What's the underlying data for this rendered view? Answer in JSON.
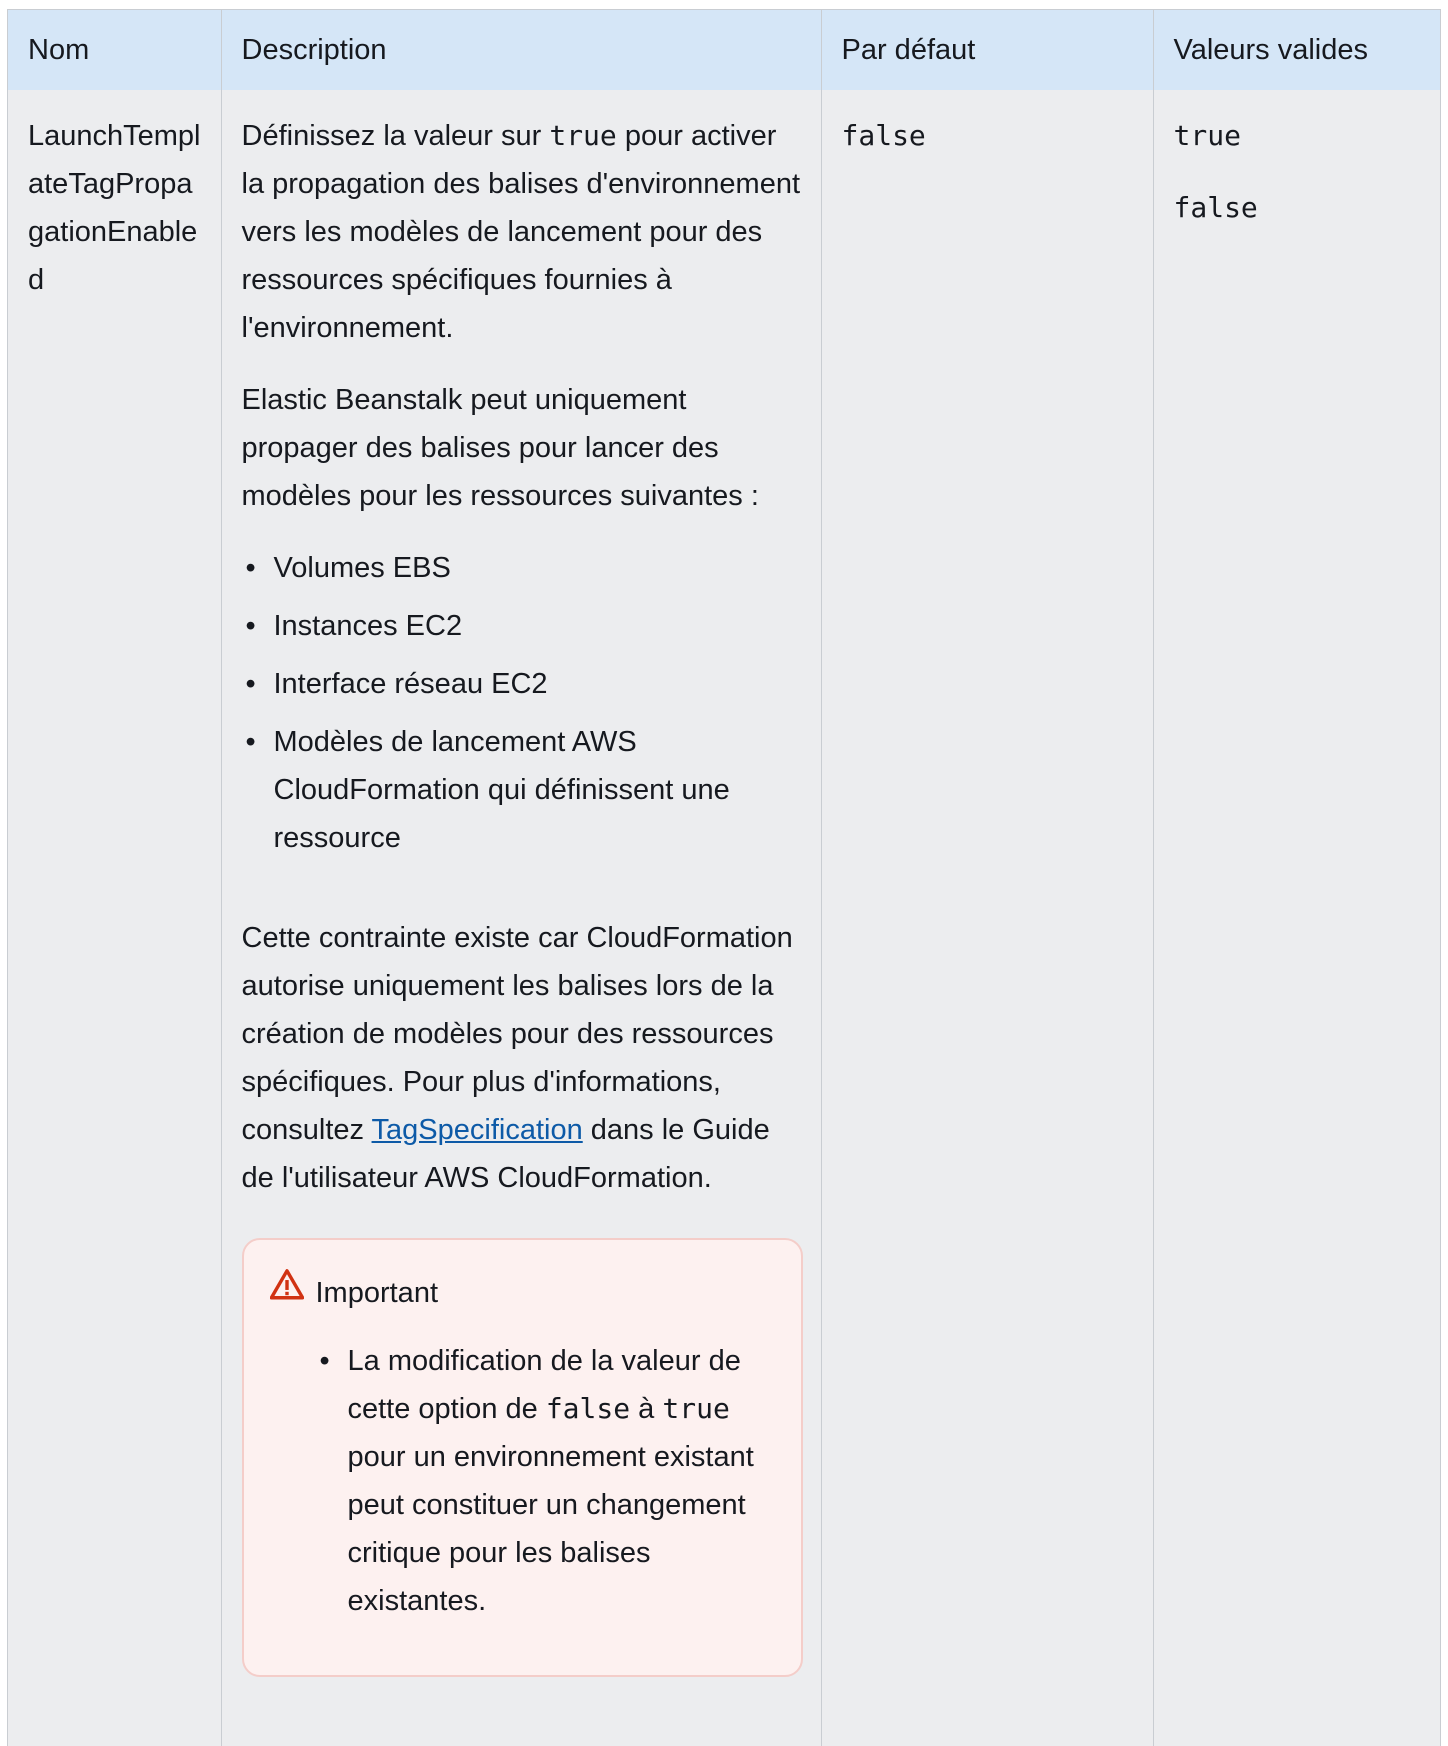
{
  "headers": {
    "name": "Nom",
    "description": "Description",
    "default": "Par défaut",
    "valid_values": "Valeurs valides"
  },
  "row": {
    "name": "LaunchTemplateTagPropagationEnabled",
    "desc_p1_before": "Définissez la valeur sur ",
    "desc_p1_code": "true",
    "desc_p1_after": " pour activer la propagation des balises d'environnement vers les modèles de lancement pour des ressources spécifiques fournies à l'environnement.",
    "desc_p2": "Elastic Beanstalk peut uniquement propager des balises pour lancer des modèles pour les ressources suivantes :",
    "resources": [
      "Volumes EBS",
      "Instances EC2",
      "Interface réseau EC2",
      "Modèles de lancement AWS CloudFormation qui définissent une ressource"
    ],
    "desc_p3_before": "Cette contrainte existe car CloudFormation autorise uniquement les balises lors de la création de modèles pour des ressources spécifiques. Pour plus d'informations, consultez ",
    "desc_p3_link": "TagSpecification",
    "desc_p3_after": " dans le Guide de l'utilisateur AWS CloudFormation.",
    "important": {
      "title": "Important",
      "item_t1": "La modification de la valeur de cette option de ",
      "item_code1": "false",
      "item_t2": " à ",
      "item_code2": "true",
      "item_t3": " pour un environnement existant peut constituer un changement critique pour les balises existantes."
    },
    "default": "false",
    "valid_values": [
      "true",
      "false"
    ]
  },
  "colors": {
    "header_bg": "#d5e6f7",
    "cell_bg": "#ecedef",
    "link": "#0d5aa7",
    "alert_bg": "#fdf1f0",
    "alert_border": "#f4cdc9",
    "warning_icon": "#d13212"
  }
}
